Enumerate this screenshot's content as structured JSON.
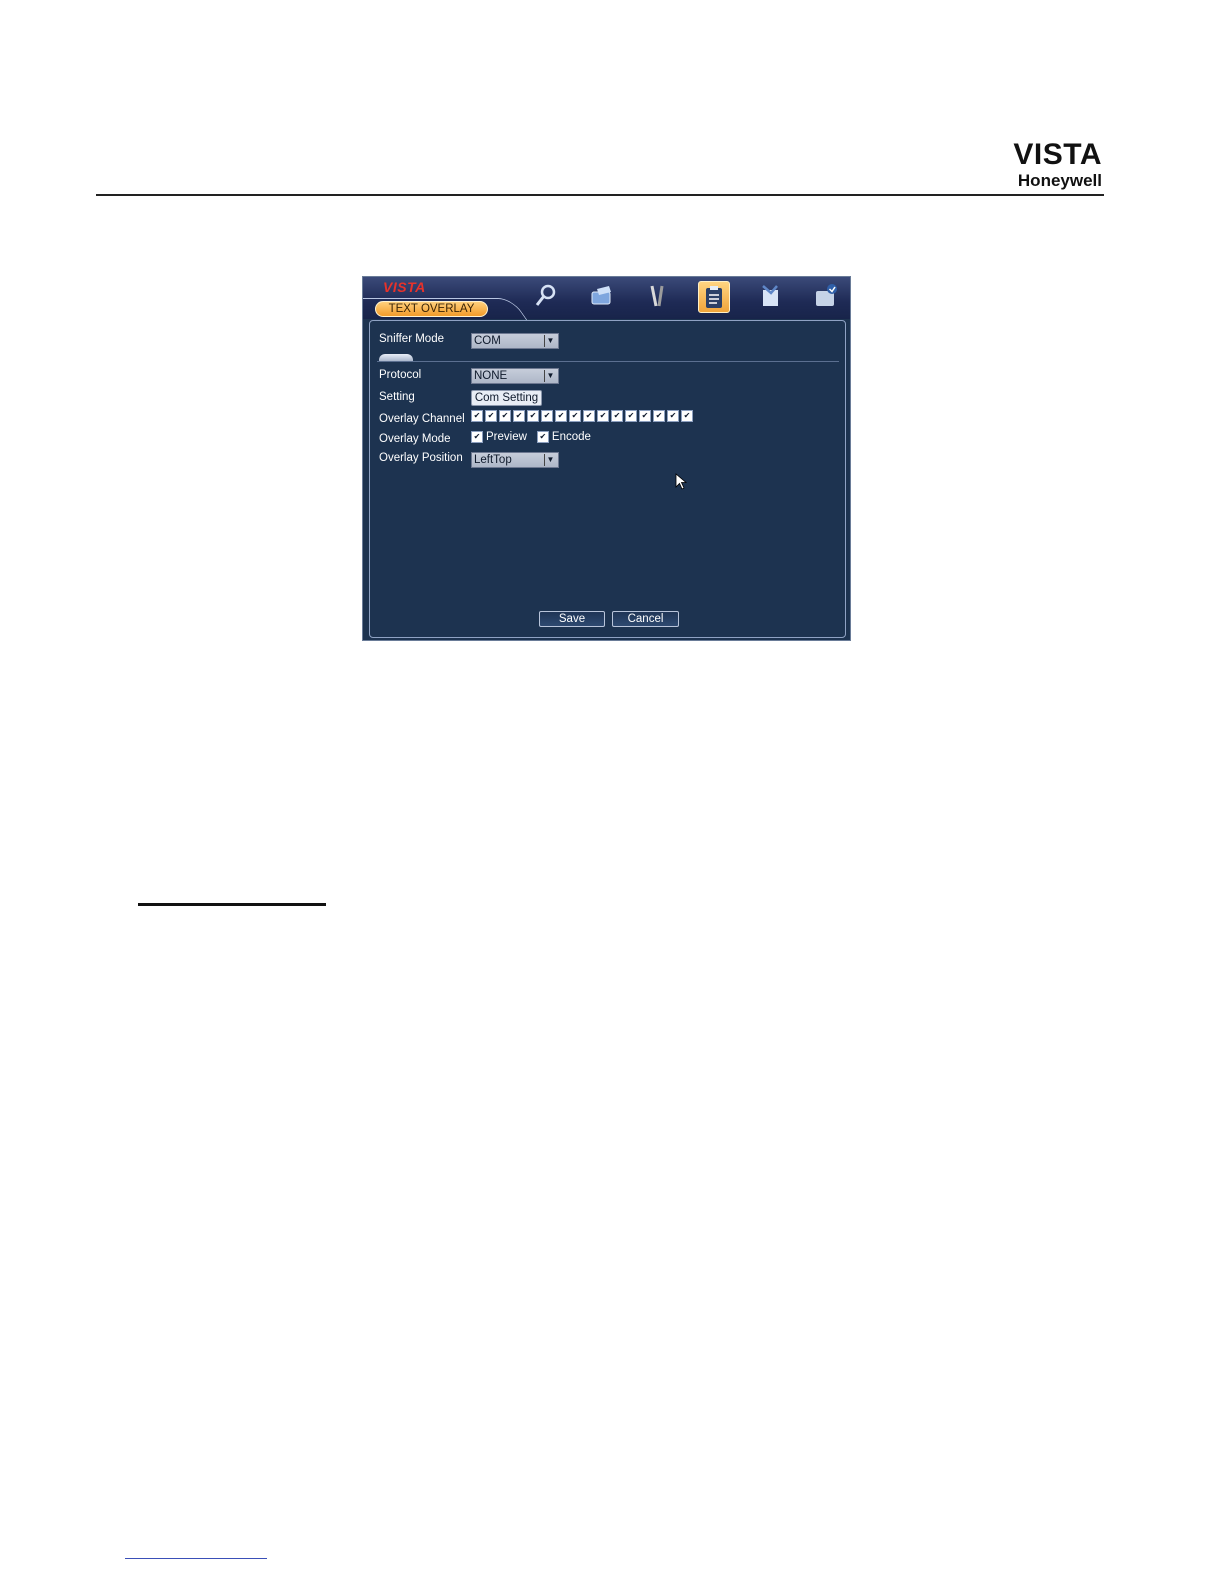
{
  "page": {
    "brand_name": "VISTA",
    "brand_company": "Honeywell"
  },
  "window": {
    "logo": "VISTA",
    "tab_label": "TEXT OVERLAY",
    "toolbar_icons": [
      "search-icon",
      "record-icon",
      "tools-icon",
      "clipboard-icon",
      "backup-icon",
      "disk-icon"
    ],
    "active_icon": "clipboard-icon"
  },
  "form": {
    "sniffer_mode": {
      "label": "Sniffer Mode",
      "value": "COM"
    },
    "protocol": {
      "label": "Protocol",
      "value": "NONE"
    },
    "setting": {
      "label": "Setting",
      "button": "Com Setting"
    },
    "overlay_channel": {
      "label": "Overlay Channel",
      "channels": [
        "1",
        "2",
        "3",
        "4",
        "5",
        "6",
        "7",
        "8",
        "9",
        "10",
        "11",
        "12",
        "13",
        "14",
        "15",
        "16"
      ],
      "checked": true
    },
    "overlay_mode": {
      "label": "Overlay Mode",
      "preview": "Preview",
      "encode": "Encode",
      "preview_checked": true,
      "encode_checked": true
    },
    "overlay_position": {
      "label": "Overlay Position",
      "value": "LeftTop"
    }
  },
  "buttons": {
    "save": "Save",
    "cancel": "Cancel"
  },
  "colors": {
    "panel_bg": "#1d3350",
    "tab_accent": "#f29b2a",
    "logo_red": "#e8322a"
  }
}
